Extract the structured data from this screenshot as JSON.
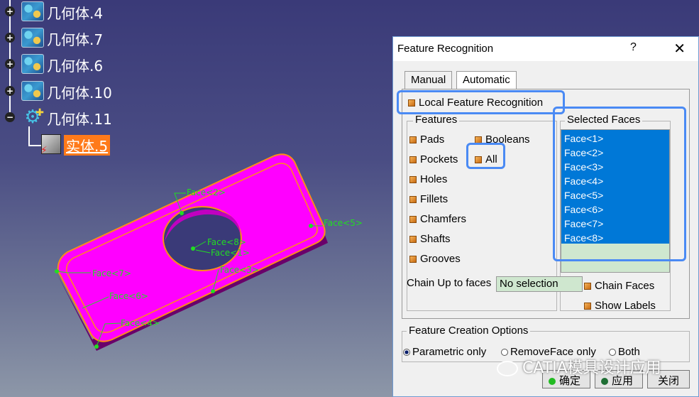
{
  "tree": {
    "nodes": [
      {
        "label": "几何体.4"
      },
      {
        "label": "几何体.7"
      },
      {
        "label": "几何体.6"
      },
      {
        "label": "几何体.10"
      },
      {
        "label": "几何体.11"
      }
    ],
    "body_label": "实体.5"
  },
  "viewport": {
    "face_labels": [
      "Face<2>",
      "Face<5>",
      "Face<8>",
      "Face<1>",
      "Face<7>",
      "Face<3>",
      "Face<6>",
      "Face<4>"
    ],
    "part_color": "#ff00ff",
    "edge_color": "#ff8c1a",
    "label_color": "#22dd22"
  },
  "dialog": {
    "title": "Feature Recognition",
    "help": "?",
    "close": "✕",
    "tabs": [
      {
        "label": "Manual"
      },
      {
        "label": "Automatic"
      }
    ],
    "local_feature_recognition": "Local Feature Recognition",
    "features_legend": "Features",
    "features_left": [
      "Pads",
      "Pockets",
      "Holes",
      "Fillets",
      "Chamfers",
      "Shafts",
      "Grooves"
    ],
    "features_right": [
      "Booleans",
      "All"
    ],
    "selected_faces_legend": "Selected Faces",
    "selected_faces": [
      "Face<1>",
      "Face<2>",
      "Face<3>",
      "Face<4>",
      "Face<5>",
      "Face<6>",
      "Face<7>",
      "Face<8>"
    ],
    "chain_label": "Chain Up to faces",
    "chain_value": "No selection",
    "chain_faces": "Chain Faces",
    "show_labels": "Show Labels",
    "creation_options_legend": "Feature Creation Options",
    "options": [
      "Parametric only",
      "RemoveFace only",
      "Both"
    ],
    "ok": "确定",
    "apply": "应用",
    "close_button": "关闭",
    "highlight_color": "#4a8af4"
  },
  "watermark": "CATIA模具设计应用"
}
